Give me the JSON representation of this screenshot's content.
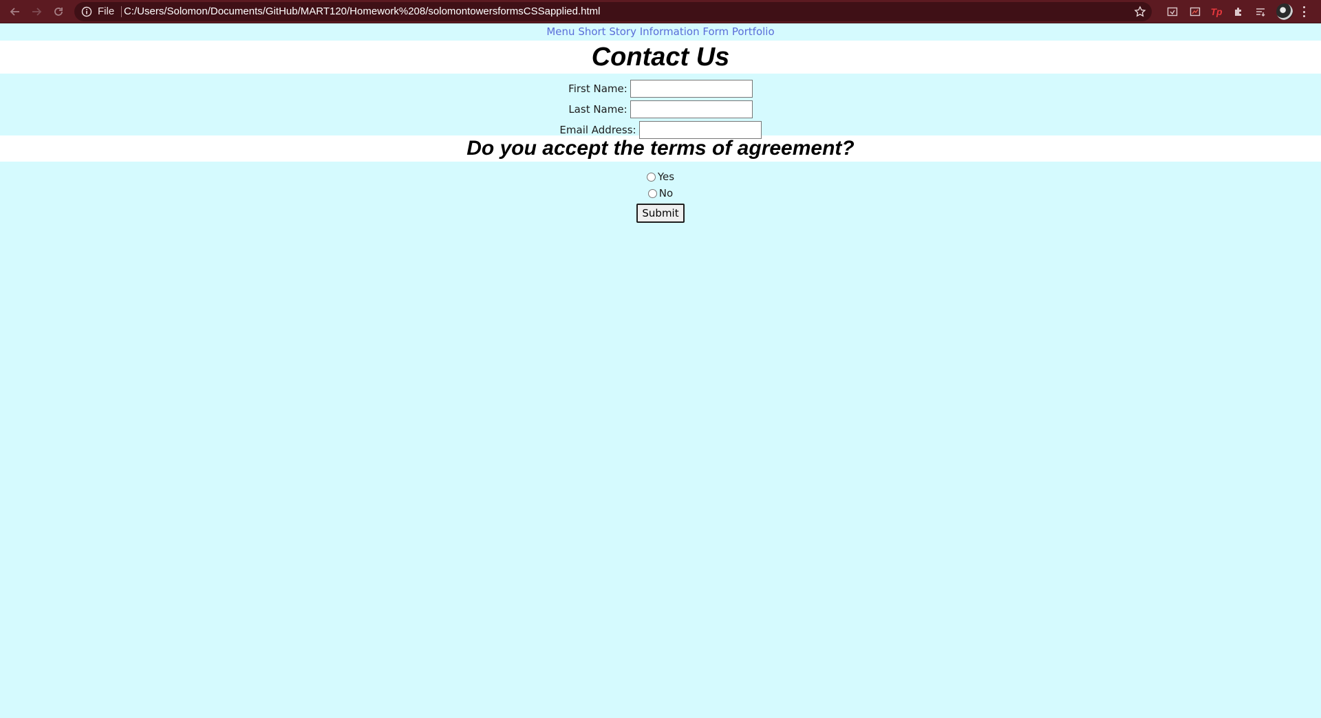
{
  "browser": {
    "scheme_label": "File",
    "url": "C:/Users/Solomon/Documents/GitHub/MART120/Homework%208/solomontowersformsCSSapplied.html",
    "extension_tp_label": "Tp",
    "icons": [
      "back-arrow-icon",
      "forward-arrow-icon",
      "reload-icon",
      "info-icon",
      "bookmark-star-icon",
      "extension-icon",
      "extensions-puzzle-icon",
      "reading-list-icon",
      "profile-avatar",
      "more-menu-icon"
    ]
  },
  "page": {
    "menu": [
      {
        "label": "Menu"
      },
      {
        "label": "Short Story"
      },
      {
        "label": "Information Form"
      },
      {
        "label": "Portfolio"
      }
    ],
    "title": "Contact Us",
    "fields": {
      "first_name": {
        "label": "First Name:",
        "value": ""
      },
      "last_name": {
        "label": "Last Name:",
        "value": ""
      },
      "email": {
        "label": "Email Address:",
        "value": ""
      }
    },
    "terms_heading": "Do you accept the terms of agreement?",
    "radios": [
      {
        "label": "Yes",
        "checked": false
      },
      {
        "label": "No",
        "checked": false
      }
    ],
    "submit_label": "Submit",
    "colors": {
      "page_background": "#d5fafe",
      "link": "#5a6dd9",
      "heading_band": "#ffffff",
      "browser_frame": "#5c1a21"
    }
  }
}
